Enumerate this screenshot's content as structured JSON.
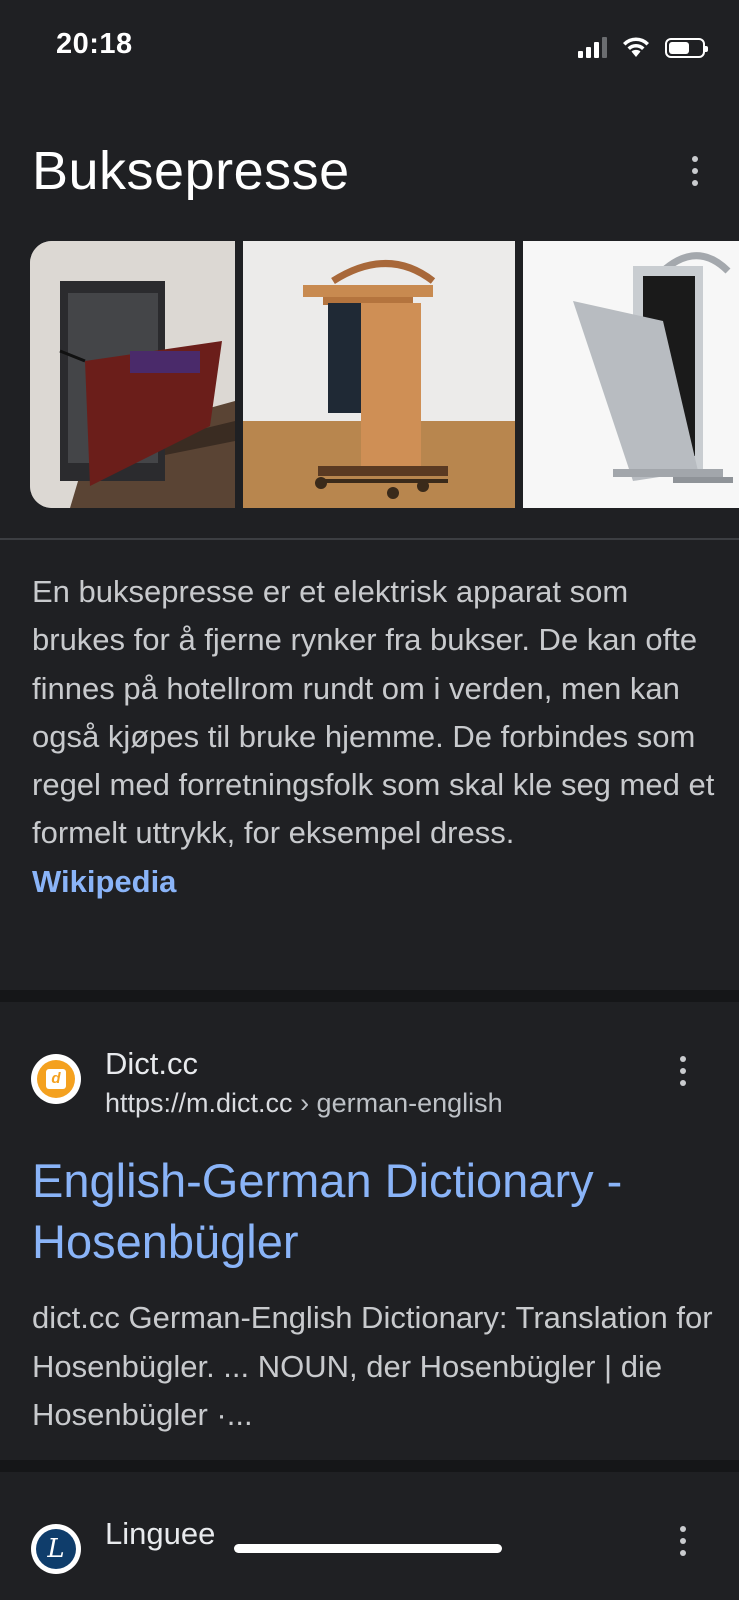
{
  "status_bar": {
    "time": "20:18"
  },
  "knowledge_panel": {
    "title": "Buksepresse",
    "images": [
      {
        "alt": "folding trouser press with red panel"
      },
      {
        "alt": "wooden valet stand with trousers"
      },
      {
        "alt": "grey standing trouser press"
      }
    ],
    "description": "En buksepresse er et elektrisk apparat som brukes for å fjerne rynker fra bukser. De kan ofte finnes på hotellrom rundt om i verden, men kan også kjøpes til bruke hjemme. De forbindes som regel med forretningsfolk som skal kle seg med et formelt uttrykk, for eksempel dress.",
    "source_link": "Wikipedia"
  },
  "results": [
    {
      "site_name": "Dict.cc",
      "url_host": "https://m.dict.cc",
      "url_path": " › german-english",
      "title": "English-German Dictionary - Hosenbügler",
      "snippet": "dict.cc German-English Dictionary: Translation for Hosenbügler. ... NOUN, der Hosenbügler | die Hosenbügler ·...",
      "favicon_letter": "d",
      "favicon_color": "#f4a11f"
    },
    {
      "site_name": "Linguee",
      "favicon_letter": "L",
      "favicon_color": "#0f3d6b"
    }
  ],
  "colors": {
    "background": "#1f2023",
    "link": "#8ab4f8",
    "text": "#c8cacd"
  }
}
